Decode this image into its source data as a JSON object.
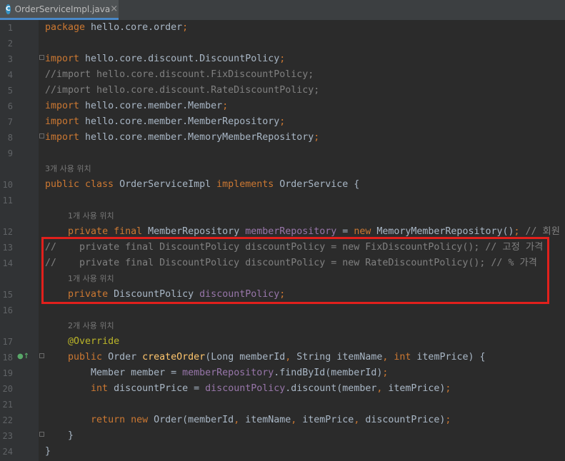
{
  "tab": {
    "icon_letter": "C",
    "label": "OrderServiceImpl.java",
    "close": "×"
  },
  "lines": [
    {
      "n": "1",
      "parts": [
        [
          "kw",
          "package "
        ],
        [
          "t",
          "hello.core.order"
        ],
        [
          "kw",
          ";"
        ]
      ]
    },
    {
      "n": "2",
      "parts": []
    },
    {
      "n": "3",
      "parts": [
        [
          "kw",
          "import "
        ],
        [
          "t",
          "hello.core.discount.DiscountPolicy"
        ],
        [
          "kw",
          ";"
        ]
      ]
    },
    {
      "n": "4",
      "parts": [
        [
          "cmt",
          "//import hello.core.discount.FixDiscountPolicy;"
        ]
      ]
    },
    {
      "n": "5",
      "parts": [
        [
          "cmt",
          "//import hello.core.discount.RateDiscountPolicy;"
        ]
      ]
    },
    {
      "n": "6",
      "parts": [
        [
          "kw",
          "import "
        ],
        [
          "t",
          "hello.core.member.Member"
        ],
        [
          "kw",
          ";"
        ]
      ]
    },
    {
      "n": "7",
      "parts": [
        [
          "kw",
          "import "
        ],
        [
          "t",
          "hello.core.member.MemberRepository"
        ],
        [
          "kw",
          ";"
        ]
      ]
    },
    {
      "n": "8",
      "parts": [
        [
          "kw",
          "import "
        ],
        [
          "t",
          "hello.core.member.MemoryMemberRepository"
        ],
        [
          "kw",
          ";"
        ]
      ]
    },
    {
      "n": "9",
      "parts": []
    },
    {
      "n": "10",
      "parts": [
        [
          "kw",
          "public class "
        ],
        [
          "t",
          "OrderServiceImpl "
        ],
        [
          "kw",
          "implements "
        ],
        [
          "t",
          "OrderService {"
        ]
      ]
    },
    {
      "n": "11",
      "parts": []
    },
    {
      "n": "12",
      "parts": [
        [
          "t",
          "    "
        ],
        [
          "kw",
          "private final "
        ],
        [
          "t",
          "MemberRepository "
        ],
        [
          "fld",
          "memberRepository"
        ],
        [
          "t",
          " = "
        ],
        [
          "kw",
          "new "
        ],
        [
          "t",
          "MemoryMemberRepository()"
        ],
        [
          "kw",
          "; "
        ],
        [
          "cmt",
          "// 회원"
        ]
      ]
    },
    {
      "n": "13",
      "parts": [
        [
          "cmt",
          "//    private final DiscountPolicy discountPolicy = new FixDiscountPolicy(); // 고정 가격"
        ]
      ]
    },
    {
      "n": "14",
      "parts": [
        [
          "cmt",
          "//    private final DiscountPolicy discountPolicy = new RateDiscountPolicy(); // % 가격"
        ]
      ]
    },
    {
      "n": "15",
      "parts": [
        [
          "t",
          "    "
        ],
        [
          "kw",
          "private "
        ],
        [
          "t",
          "DiscountPolicy "
        ],
        [
          "fld",
          "discountPolicy"
        ],
        [
          "kw",
          ";"
        ]
      ]
    },
    {
      "n": "16",
      "parts": []
    },
    {
      "n": "17",
      "parts": [
        [
          "t",
          "    "
        ],
        [
          "ann",
          "@Override"
        ]
      ]
    },
    {
      "n": "18",
      "parts": [
        [
          "t",
          "    "
        ],
        [
          "kw",
          "public "
        ],
        [
          "t",
          "Order "
        ],
        [
          "fn",
          "createOrder"
        ],
        [
          "t",
          "(Long memberId"
        ],
        [
          "kw",
          ", "
        ],
        [
          "t",
          "String itemName"
        ],
        [
          "kw",
          ", int "
        ],
        [
          "t",
          "itemPrice) {"
        ]
      ]
    },
    {
      "n": "19",
      "parts": [
        [
          "t",
          "        Member member = "
        ],
        [
          "fld",
          "memberRepository"
        ],
        [
          "t",
          ".findById(memberId)"
        ],
        [
          "kw",
          ";"
        ]
      ]
    },
    {
      "n": "20",
      "parts": [
        [
          "t",
          "        "
        ],
        [
          "kw",
          "int "
        ],
        [
          "t",
          "discountPrice = "
        ],
        [
          "fld",
          "discountPolicy"
        ],
        [
          "t",
          ".discount(member"
        ],
        [
          "kw",
          ", "
        ],
        [
          "t",
          "itemPrice)"
        ],
        [
          "kw",
          ";"
        ]
      ]
    },
    {
      "n": "21",
      "parts": []
    },
    {
      "n": "22",
      "parts": [
        [
          "t",
          "        "
        ],
        [
          "kw",
          "return new "
        ],
        [
          "t",
          "Order(memberId"
        ],
        [
          "kw",
          ", "
        ],
        [
          "t",
          "itemName"
        ],
        [
          "kw",
          ", "
        ],
        [
          "t",
          "itemPrice"
        ],
        [
          "kw",
          ", "
        ],
        [
          "t",
          "discountPrice)"
        ],
        [
          "kw",
          ";"
        ]
      ]
    },
    {
      "n": "23",
      "parts": [
        [
          "t",
          "    }"
        ]
      ]
    },
    {
      "n": "24",
      "parts": [
        [
          "t",
          "}"
        ]
      ]
    }
  ],
  "hints": {
    "class_usages": "3개 사용 위치",
    "member_repo_usages": "1개 사용 위치",
    "discount_policy_usages": "1개 사용 위치",
    "create_order_usages": "2개 사용 위치"
  },
  "colors": {
    "highlight_box": "#e1201c",
    "keyword": "#cc7832",
    "comment": "#808080",
    "field": "#9876aa",
    "annotation": "#bbb529",
    "method": "#ffc66d"
  }
}
